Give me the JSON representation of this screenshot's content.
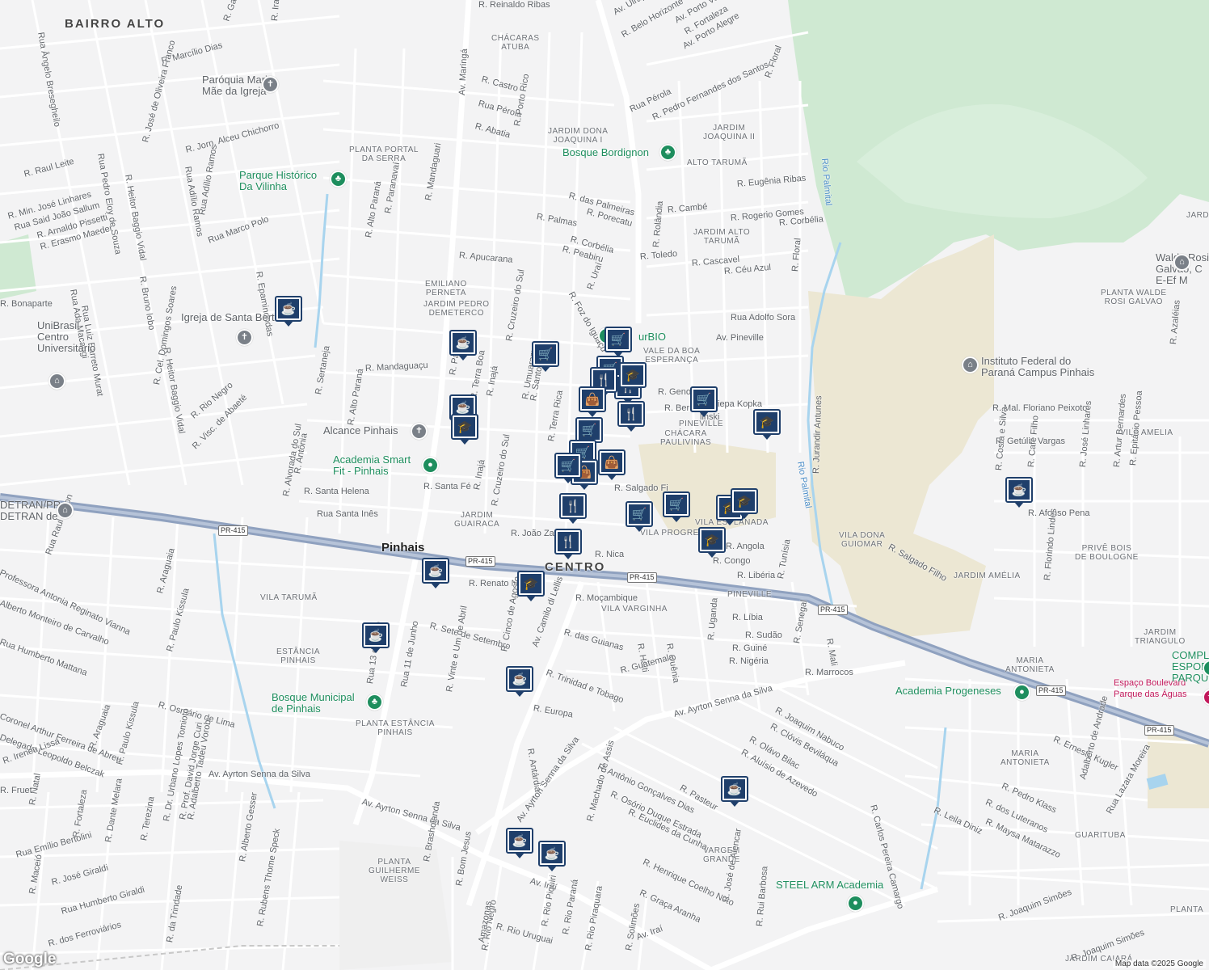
{
  "map": {
    "attribution": "Map data ©2025 Google",
    "logo": "Google",
    "colors": {
      "background": "#f3f3f4",
      "green_area": "#cfe9d2",
      "sand_area": "#ece7d3",
      "road": "#ffffff",
      "highway": "#8fa1bf",
      "river": "#a8d4ee",
      "pin": "#1f3f6b"
    },
    "districts": [
      {
        "text": "BAIRRO ALTO"
      },
      {
        "text": "CENTRO"
      }
    ],
    "cities": [
      {
        "text": "Pinhais"
      }
    ],
    "areas": [
      {
        "text": "CHÁCARAS\nATUBA"
      },
      {
        "text": "JARDIM DONA\nJOAQUINA I"
      },
      {
        "text": "JARDIM\nJOAQUINA II"
      },
      {
        "text": "ALTO TARUMÃ"
      },
      {
        "text": "JARDIM ALTO\nTARUMÃ"
      },
      {
        "text": "PLANTA PORTAL\nDA SERRA"
      },
      {
        "text": "EMILIANO\nPERNETA"
      },
      {
        "text": "JARDIM PEDRO\nDEMETERCO"
      },
      {
        "text": "VALE DA BOA\nESPERANÇA"
      },
      {
        "text": "PINEVILLE"
      },
      {
        "text": "CHÁCARA\nPAULIVINAS"
      },
      {
        "text": "JARDIM\nGUAIRACA"
      },
      {
        "text": "VILA PROGRESSO"
      },
      {
        "text": "VILA ESPLANADA"
      },
      {
        "text": "PINEVILLE"
      },
      {
        "text": "VILA TARUMÃ"
      },
      {
        "text": "ESTÂNCIA\nPINHAIS"
      },
      {
        "text": "VILA VARGINHA"
      },
      {
        "text": "PLANTA ESTÂNCIA\nPINHAIS"
      },
      {
        "text": "VILA DONA\nGUIOMAR"
      },
      {
        "text": "JARDIM AMÉLIA"
      },
      {
        "text": "VILA AMELIA"
      },
      {
        "text": "PRIVÊ BOIS\nDE BOULOGNE"
      },
      {
        "text": "JARDIM\nTRIANGULO"
      },
      {
        "text": "MARIA\nANTONIETA"
      },
      {
        "text": "MARIA\nANTONIETA"
      },
      {
        "text": "GUARITUBA"
      },
      {
        "text": "VARGEM\nGRANDE"
      },
      {
        "text": "PLANTA\nGUILHERME\nWEISS"
      },
      {
        "text": "PLANTA WALDE\nROSI GALVAO"
      },
      {
        "text": "PLANTA"
      },
      {
        "text": "JARDIM CAIARÁ"
      },
      {
        "text": "JARD"
      }
    ],
    "roads": [
      {
        "text": "R. Reinaldo Ribas"
      },
      {
        "text": "R. Castro"
      },
      {
        "text": "Rua Pérola"
      },
      {
        "text": "R. Abatia"
      },
      {
        "text": "R. Porto Rico"
      },
      {
        "text": "Av. Maringá"
      },
      {
        "text": "R. das Palmeiras"
      },
      {
        "text": "R. Palmas"
      },
      {
        "text": "R. Porecatu"
      },
      {
        "text": "R. Corbélia"
      },
      {
        "text": "R. Peabiru"
      },
      {
        "text": "R. Apucarana"
      },
      {
        "text": "R. Uraí"
      },
      {
        "text": "R. Foz do Iguaçu"
      },
      {
        "text": "R. Toledo"
      },
      {
        "text": "R. Cascavel"
      },
      {
        "text": "R. Céu Azul"
      },
      {
        "text": "R. Rolândia"
      },
      {
        "text": "R. Cambé"
      },
      {
        "text": "R. Eugênia Ribas"
      },
      {
        "text": "R. Rogerio Gomes"
      },
      {
        "text": "R. Corbélia"
      },
      {
        "text": "R. Floral"
      },
      {
        "text": "R. Floral"
      },
      {
        "text": "Rua Adolfo Sora"
      },
      {
        "text": "Av. Pineville"
      },
      {
        "text": "Rio Palmital"
      },
      {
        "text": "Rio Palmital"
      },
      {
        "text": "R. Jurandir Antunes"
      },
      {
        "text": "R. Mal. Floriano Peixoto"
      },
      {
        "text": "R. Getúlio Vargas"
      },
      {
        "text": "R. Genov"
      },
      {
        "text": "R. Ber"
      },
      {
        "text": "iepa Kopka"
      },
      {
        "text": "linski"
      },
      {
        "text": "R. Marcílio Dias"
      },
      {
        "text": "R. Jorn. Alceu Chichorro"
      },
      {
        "text": "Rua Adílio Ramos"
      },
      {
        "text": "Rua Adílio Ramos"
      },
      {
        "text": "R. José de Oliveira Franco"
      },
      {
        "text": "R. Raul Leite"
      },
      {
        "text": "R. Min. José Linhares"
      },
      {
        "text": "Rua Said João Sallum"
      },
      {
        "text": "R. Arnaldo Pissetti"
      },
      {
        "text": "R. Erasmo Maeder"
      },
      {
        "text": "Rua Marco Polo"
      },
      {
        "text": "R. Epaminondas"
      },
      {
        "text": "R. Bruno lobo"
      },
      {
        "text": "R. Heitor Baggio Vidal"
      },
      {
        "text": "Rua Pedro Eloy de Souza"
      },
      {
        "text": "Rua Ângelo Bresegheilo"
      },
      {
        "text": "R. Alto Paraná"
      },
      {
        "text": "R. Paranavaí"
      },
      {
        "text": "R. Mandaguari"
      },
      {
        "text": "R. Mandaguaçu"
      },
      {
        "text": "R. Cruzeiro do Sul"
      },
      {
        "text": "R. Inajá"
      },
      {
        "text": "R. Terra Boa"
      },
      {
        "text": "R. Paraíso"
      },
      {
        "text": "R. Santo Inácio"
      },
      {
        "text": "R. Terra Rica"
      },
      {
        "text": "R. Umuarama"
      },
      {
        "text": "R. Visc. de Abaeté"
      },
      {
        "text": "R. Rio Negro"
      },
      {
        "text": "R. Sertaneja"
      },
      {
        "text": "R. Alto Paraná"
      },
      {
        "text": "R. Antônia"
      },
      {
        "text": "R. Alvorada do Sul"
      },
      {
        "text": "R. Santa Fé"
      },
      {
        "text": "R. Santa Helena"
      },
      {
        "text": "Rua Santa Inês"
      },
      {
        "text": "R. Inajá"
      },
      {
        "text": "R. Cruzeiro do Sul"
      },
      {
        "text": "R. João Za"
      },
      {
        "text": "R. Nica"
      },
      {
        "text": "R. Salgado Fi"
      },
      {
        "text": "R. Angola"
      },
      {
        "text": "R. Congo"
      },
      {
        "text": "R. Libéria"
      },
      {
        "text": "R. Tunísia"
      },
      {
        "text": "R. Salgado Filho"
      },
      {
        "text": "R. Renato Nu"
      },
      {
        "text": "nes"
      },
      {
        "text": "R. Moçambique"
      },
      {
        "text": "R. Líbia"
      },
      {
        "text": "R. Sudão"
      },
      {
        "text": "R. Guiné"
      },
      {
        "text": "R. Nigéria"
      },
      {
        "text": "R. Uganda"
      },
      {
        "text": "R. Senegal"
      },
      {
        "text": "R. Mali"
      },
      {
        "text": "R. Marrocos"
      },
      {
        "text": "R. Sete de Setembro"
      },
      {
        "text": "R. das Guianas"
      },
      {
        "text": "R. Haiti"
      },
      {
        "text": "R. Quênia"
      },
      {
        "text": "R. Guatemala"
      },
      {
        "text": "R. Trinidad e Tobago"
      },
      {
        "text": "R. Europa"
      },
      {
        "text": "Av. Camilo di Lellis"
      },
      {
        "text": "R. Cinco de Agosto"
      },
      {
        "text": "R. Vinte e Um de Abril"
      },
      {
        "text": "Rua 11 de Junho"
      },
      {
        "text": "Rua 13 de Maio"
      },
      {
        "text": "Rua Raul Caron"
      },
      {
        "text": "R. Araguaia"
      },
      {
        "text": "R. Araguaia"
      },
      {
        "text": "R. Paulo Kissula"
      },
      {
        "text": "R. Paulo Kissula"
      },
      {
        "text": "R. Osmário de Lima"
      },
      {
        "text": "Professora Antonia Reginato Vianna"
      },
      {
        "text": "Alberto Monteiro de Carvalho"
      },
      {
        "text": "Rua Humberto Mattana"
      },
      {
        "text": "Coronel Arthur Ferreira de Abreu"
      },
      {
        "text": "Delegado Leopoldo Belczak"
      },
      {
        "text": "R. Ireneu Lissa"
      },
      {
        "text": "Av. Ayrton Senna da Silva"
      },
      {
        "text": "Av. Ayrton Senna da Silva"
      },
      {
        "text": "Av. Ayrton Senna da Silva"
      },
      {
        "text": "Av. Ayrton Senna da Silva"
      },
      {
        "text": "R. Joaquim Nabuco"
      },
      {
        "text": "R. Clóvis Beviláqua"
      },
      {
        "text": "R. Olávo Bilac"
      },
      {
        "text": "R. Aluísio de Azevedo"
      },
      {
        "text": "R. Pasteur"
      },
      {
        "text": "R. Antônio Gonçalves Dias"
      },
      {
        "text": "R. Osório Duque Estrada"
      },
      {
        "text": "R. Euclides da Cunha"
      },
      {
        "text": "R. Henrique Coelho Neto"
      },
      {
        "text": "R. Graça Aranha"
      },
      {
        "text": "R. José de Alencar"
      },
      {
        "text": "R. Rui Barbosa"
      },
      {
        "text": "R. Machado de Assis"
      },
      {
        "text": "R. Antárdia"
      },
      {
        "text": "R. Carlos Pereira Camargo"
      },
      {
        "text": "R. Leila Diniz"
      },
      {
        "text": "R. Maysa Matarazzo"
      },
      {
        "text": "R. dos Luteranos"
      },
      {
        "text": "R. Pedro Klass"
      },
      {
        "text": "R. Ernesto Kugler"
      },
      {
        "text": "Adalberto de Andrade"
      },
      {
        "text": "Rua Lazara Moreira"
      },
      {
        "text": "R. Joaquim Simões"
      },
      {
        "text": "R. Joaquim Simões"
      },
      {
        "text": "Av. Iraí"
      },
      {
        "text": "Av. Iraí"
      },
      {
        "text": "R. Brasholanda"
      },
      {
        "text": "R. Bom Jesus"
      },
      {
        "text": "R. Rio Uruguai"
      },
      {
        "text": "R. Rio Negro"
      },
      {
        "text": "R. Rio Piquiri"
      },
      {
        "text": "R. Rio Paraná"
      },
      {
        "text": "R. Rio Piraquara"
      },
      {
        "text": "R. Solimões"
      },
      {
        "text": "Amazonas"
      },
      {
        "text": "R. dos Ferroviários"
      },
      {
        "text": "R. da Trindade"
      },
      {
        "text": "R. Terezina"
      },
      {
        "text": "R. Dante Melara"
      },
      {
        "text": "R. Fortaleza"
      },
      {
        "text": "R. Natal"
      },
      {
        "text": "R. José Giraldi"
      },
      {
        "text": "Rua Emílio Bertolini"
      },
      {
        "text": "R. Maceió"
      },
      {
        "text": "Rua Humberto Giraldi"
      },
      {
        "text": "R. Adalberto Tadeu Vorobi"
      },
      {
        "text": "R. Prof. David Jorge Curi"
      },
      {
        "text": "R. Dr. Urbano Lopes Tomioto"
      },
      {
        "text": "R. Alberto Gesser"
      },
      {
        "text": "R. Rubens Thome Speck"
      },
      {
        "text": "R. Artur Bernardes"
      },
      {
        "text": "R. Epitácio Pessoa"
      },
      {
        "text": "R. José Linhares"
      },
      {
        "text": "R. Café Filho"
      },
      {
        "text": "R. Costa e Silva"
      },
      {
        "text": "R. Afonso Pena"
      },
      {
        "text": "R. Florindo Lindes"
      },
      {
        "text": "R. Azaléias"
      },
      {
        "text": "Av. Porto Alegre"
      },
      {
        "text": "R. Fortaleza"
      },
      {
        "text": "Av. Porto Velho"
      },
      {
        "text": "R. Belo Horizonte"
      },
      {
        "text": "Av. Uirapuru"
      },
      {
        "text": "R. Pedro Fernandes dos Santos"
      },
      {
        "text": "Rua Pérola"
      },
      {
        "text": "R. Gastão Luiz Cruls"
      },
      {
        "text": "R. Iraguari"
      },
      {
        "text": "R. Cel. Domingos Soares"
      },
      {
        "text": "Rua Ada Macaggi"
      },
      {
        "text": "Rua Luiz Barreto Murat"
      },
      {
        "text": "R. Heitor Baggio Vidal"
      },
      {
        "text": "R. Bonaparte"
      },
      {
        "text": "R. Fruet"
      }
    ],
    "highway_shields": [
      {
        "text": "PR-415"
      },
      {
        "text": "PR-415"
      },
      {
        "text": "PR-415"
      },
      {
        "text": "PR-415"
      },
      {
        "text": "PR-415"
      },
      {
        "text": "PR-415"
      }
    ],
    "pois": [
      {
        "text": "Paróquia Maria\nMãe da Igreja",
        "icon": "church-icon",
        "kind": "gray"
      },
      {
        "text": "Parque Histórico\nDa Vilinha",
        "icon": "park-icon",
        "kind": "green"
      },
      {
        "text": "Bosque Bordignon",
        "icon": "park-icon",
        "kind": "green"
      },
      {
        "text": "Igreja de Santa Bertila",
        "icon": "church-icon",
        "kind": "gray"
      },
      {
        "text": "UniBrasil\nCentro\nUniversitário",
        "icon": "school-icon",
        "kind": "gray"
      },
      {
        "text": "Alcance Pinhais",
        "icon": "church-icon",
        "kind": "gray"
      },
      {
        "text": "Academia Smart\nFit - Pinhais",
        "icon": "gym-icon",
        "kind": "green"
      },
      {
        "text": "Bosque Municipal\nde Pinhais",
        "icon": "park-icon",
        "kind": "green"
      },
      {
        "text": "Instituto Federal do\nParaná Campus Pinhais",
        "icon": "school-icon",
        "kind": "gray"
      },
      {
        "text": "Walde Rosi\nGalvao, C E-Ef M",
        "icon": "school-icon",
        "kind": "gray"
      },
      {
        "text": "Academia Progeneses",
        "icon": "gym-icon",
        "kind": "green"
      },
      {
        "text": "Espaço Boulevard\nParque das Águas",
        "icon": "event-icon",
        "kind": "pink"
      },
      {
        "text": "COMPLEXO\nESPORTIVO PARQUE",
        "icon": "sport-icon",
        "kind": "green"
      },
      {
        "text": "STEEL ARM Academia",
        "icon": "gym-icon",
        "kind": "green"
      },
      {
        "text": "urBIO",
        "icon": "market-icon",
        "kind": "green"
      },
      {
        "text": "DETRAN/PR -\nDETRAN de",
        "icon": "gov-icon",
        "kind": "gray"
      }
    ],
    "markers": [
      {
        "type": "cafe",
        "icon": "coffee-icon"
      },
      {
        "type": "cafe",
        "icon": "coffee-icon"
      },
      {
        "type": "grocery",
        "icon": "cart-icon"
      },
      {
        "type": "grocery",
        "icon": "cart-icon"
      },
      {
        "type": "grocery",
        "icon": "cart-icon"
      },
      {
        "type": "restaurant",
        "icon": "fork-knife-icon"
      },
      {
        "type": "school",
        "icon": "graduation-cap-icon"
      },
      {
        "type": "restaurant",
        "icon": "fork-knife-icon"
      },
      {
        "type": "shopping",
        "icon": "shopping-bag-icon"
      },
      {
        "type": "cafe",
        "icon": "coffee-icon"
      },
      {
        "type": "school",
        "icon": "graduation-cap-icon"
      },
      {
        "type": "grocery",
        "icon": "cart-icon"
      },
      {
        "type": "school",
        "icon": "graduation-cap-icon"
      },
      {
        "type": "grocery",
        "icon": "cart-icon"
      },
      {
        "type": "grocery",
        "icon": "cart-icon"
      },
      {
        "type": "shopping",
        "icon": "shopping-bag-icon"
      },
      {
        "type": "shopping",
        "icon": "shopping-bag-icon"
      },
      {
        "type": "restaurant",
        "icon": "fork-knife-icon"
      },
      {
        "type": "grocery",
        "icon": "cart-icon"
      },
      {
        "type": "grocery",
        "icon": "cart-icon"
      },
      {
        "type": "school",
        "icon": "graduation-cap-icon"
      },
      {
        "type": "school",
        "icon": "graduation-cap-icon"
      },
      {
        "type": "school",
        "icon": "graduation-cap-icon"
      },
      {
        "type": "restaurant",
        "icon": "fork-knife-icon"
      },
      {
        "type": "restaurant",
        "icon": "fork-knife-icon"
      },
      {
        "type": "grocery",
        "icon": "cart-icon"
      },
      {
        "type": "cafe",
        "icon": "coffee-icon"
      },
      {
        "type": "school",
        "icon": "graduation-cap-icon"
      },
      {
        "type": "cafe",
        "icon": "coffee-icon"
      },
      {
        "type": "cafe",
        "icon": "coffee-icon"
      },
      {
        "type": "cafe",
        "icon": "coffee-icon"
      },
      {
        "type": "cafe",
        "icon": "coffee-icon"
      },
      {
        "type": "cafe",
        "icon": "coffee-icon"
      },
      {
        "type": "cafe",
        "icon": "coffee-icon"
      }
    ]
  }
}
